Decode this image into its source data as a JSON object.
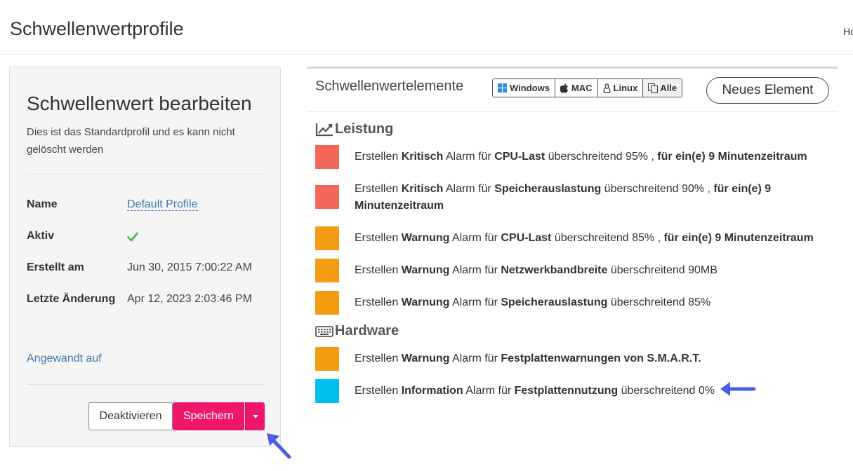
{
  "page": {
    "title": "Schwellenwertprofile",
    "breadcrumb": "Ho"
  },
  "edit_panel": {
    "title": "Schwellenwert bearbeiten",
    "description": "Dies ist das Standardprofil und es kann nicht gelöscht werden",
    "fields": {
      "name_label": "Name",
      "name_value": "Default Profile",
      "active_label": "Aktiv",
      "active_icon": "check-icon",
      "created_label": "Erstellt am",
      "created_value": "Jun 30, 2015 7:00:22 AM",
      "modified_label": "Letzte Änderung",
      "modified_value": "Apr 12, 2023 2:03:46 PM"
    },
    "applied_link": "Angewandt auf",
    "buttons": {
      "deactivate": "Deaktivieren",
      "save": "Speichern"
    }
  },
  "elements_panel": {
    "title": "Schwellenwertelemente",
    "os_filters": [
      "Windows",
      "MAC",
      "Linux",
      "Alle"
    ],
    "active_filter": "Alle",
    "new_button": "Neues Element",
    "sections": [
      {
        "name": "Leistung",
        "icon": "line-chart-icon",
        "items": [
          {
            "color": "#f4665a",
            "pre": "Erstellen ",
            "severity": "Kritisch",
            "mid": " Alarm für ",
            "metric": "CPU-Last",
            "cond": " überschreitend 95% , ",
            "period": "für ein(e) 9 Minutenzeitraum"
          },
          {
            "color": "#f4665a",
            "pre": "Erstellen ",
            "severity": "Kritisch",
            "mid": " Alarm für ",
            "metric": "Speicherauslastung",
            "cond": " überschreitend 90% , ",
            "period": "für ein(e) 9 Minutenzeitraum"
          },
          {
            "color": "#f39c12",
            "pre": "Erstellen ",
            "severity": "Warnung",
            "mid": " Alarm für ",
            "metric": "CPU-Last",
            "cond": " überschreitend 85% , ",
            "period": "für ein(e) 9 Minutenzeitraum"
          },
          {
            "color": "#f39c12",
            "pre": "Erstellen ",
            "severity": "Warnung",
            "mid": " Alarm für ",
            "metric": "Netzwerkbandbreite",
            "cond": " überschreitend 90MB",
            "period": ""
          },
          {
            "color": "#f39c12",
            "pre": "Erstellen ",
            "severity": "Warnung",
            "mid": " Alarm für ",
            "metric": "Speicherauslastung",
            "cond": " überschreitend 85%",
            "period": ""
          }
        ]
      },
      {
        "name": "Hardware",
        "icon": "keyboard-icon",
        "items": [
          {
            "color": "#f39c12",
            "pre": "Erstellen ",
            "severity": "Warnung",
            "mid": " Alarm für ",
            "metric": "Festplattenwarnungen von S.M.A.R.T.",
            "cond": "",
            "period": ""
          },
          {
            "color": "#00c0ef",
            "pre": "Erstellen ",
            "severity": "Information",
            "mid": " Alarm für ",
            "metric": "Festplattennutzung",
            "cond": " überschreitend 0%",
            "period": ""
          }
        ]
      }
    ]
  },
  "colors": {
    "accent": "#f0166e",
    "link": "#3c7ab4",
    "critical": "#f4665a",
    "warning": "#f39c12",
    "info": "#00c0ef",
    "annotation_arrow": "#4a5be8"
  }
}
